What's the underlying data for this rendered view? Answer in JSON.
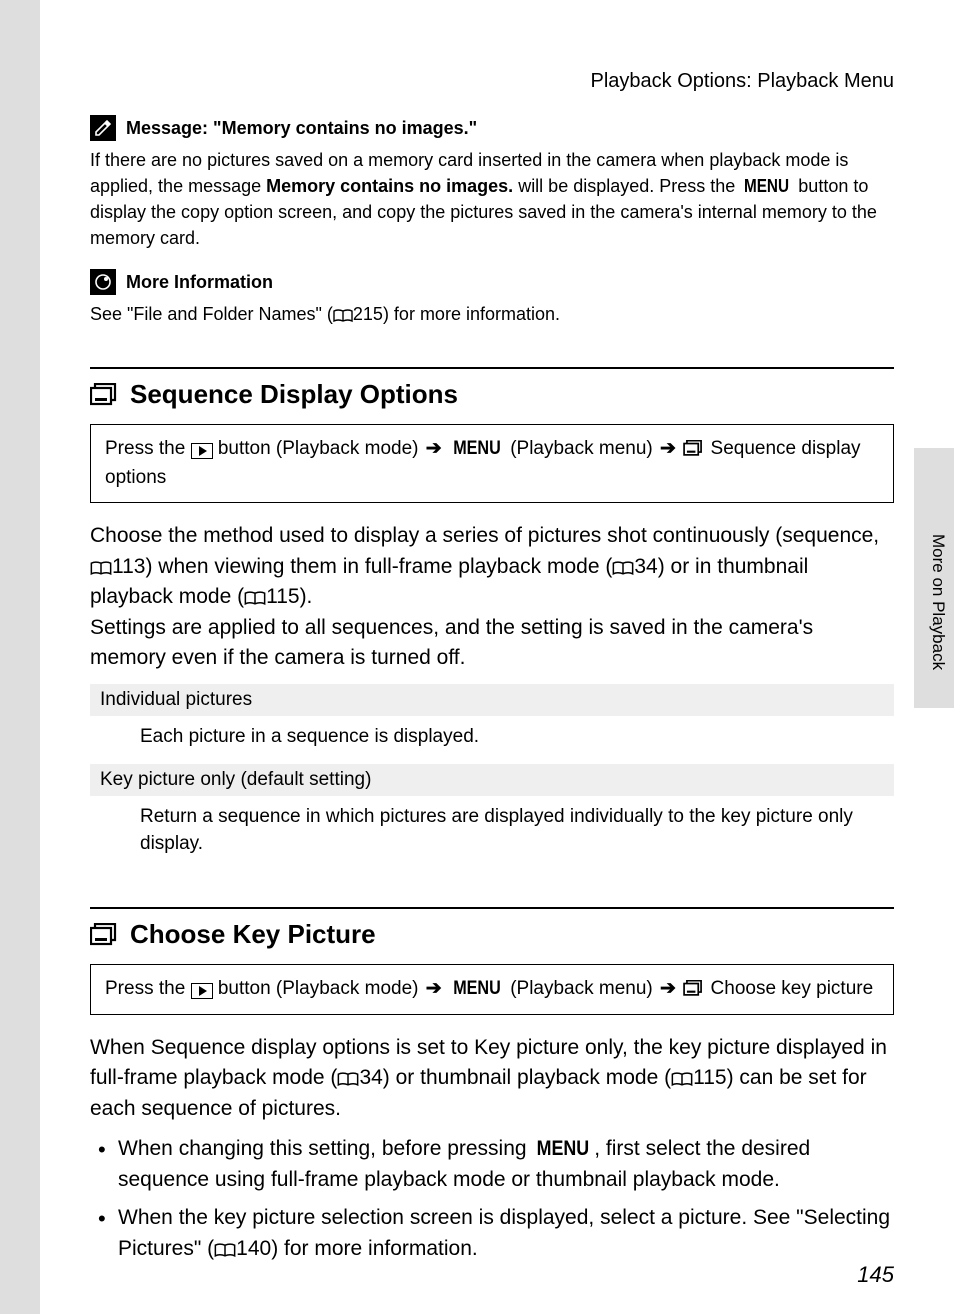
{
  "breadcrumb": "Playback Options: Playback Menu",
  "note1": {
    "title": "Message: \"Memory contains no images.\"",
    "line1a": "If there are no pictures saved on a memory card inserted in the camera when playback mode is applied, the message ",
    "bold1": "Memory contains no images.",
    "line1b": " will be displayed. Press the ",
    "menu": "MENU",
    "line1c": " button to display the copy option screen, and copy the pictures saved in the camera's internal memory to the memory card."
  },
  "note2": {
    "title": "More Information",
    "body_a": "See \"File and Folder Names\" (",
    "ref": "215",
    "body_b": ") for more information."
  },
  "section1": {
    "title": "Sequence Display Options",
    "nav_a": "Press the ",
    "nav_b": " button (Playback mode) ",
    "nav_menu": "MENU",
    "nav_c": " (Playback menu) ",
    "nav_d": " Sequence display options",
    "body1_a": "Choose the method used to display a series of pictures shot continuously (sequence, ",
    "ref1": "113",
    "body1_b": ") when viewing them in full-frame playback mode (",
    "ref2": "34",
    "body1_c": ") or in thumbnail playback mode (",
    "ref3": "115",
    "body1_d": ").",
    "body2": "Settings are applied to all sequences, and the setting is saved in the camera's memory even if the camera is turned off.",
    "opt1_title": "Individual pictures",
    "opt1_body": "Each picture in a sequence is displayed.",
    "opt2_title": "Key picture only (default setting)",
    "opt2_body": "Return a sequence in which pictures are displayed individually to the key picture only display."
  },
  "section2": {
    "title": "Choose Key Picture",
    "nav_a": "Press the ",
    "nav_b": " button (Playback mode) ",
    "nav_menu": "MENU",
    "nav_c": " (Playback menu) ",
    "nav_d": " Choose key picture",
    "body1_a": "When ",
    "bold1": "Sequence display options",
    "body1_b": " is set to ",
    "bold2": "Key picture only",
    "body1_c": ", the key picture displayed in full-frame playback mode (",
    "ref1": "34",
    "body1_d": ") or thumbnail playback mode (",
    "ref2": "115",
    "body1_e": ") can be set for each sequence of pictures.",
    "bullet1_a": "When changing this setting, before pressing ",
    "bullet1_menu": "MENU",
    "bullet1_b": ", first select the desired sequence using full-frame playback mode or thumbnail playback mode.",
    "bullet2_a": "When the key picture selection screen is displayed, select a picture. See \"Selecting Pictures\" (",
    "bullet2_ref": "140",
    "bullet2_b": ") for more information."
  },
  "side_tab": "More on Playback",
  "page_number": "145"
}
